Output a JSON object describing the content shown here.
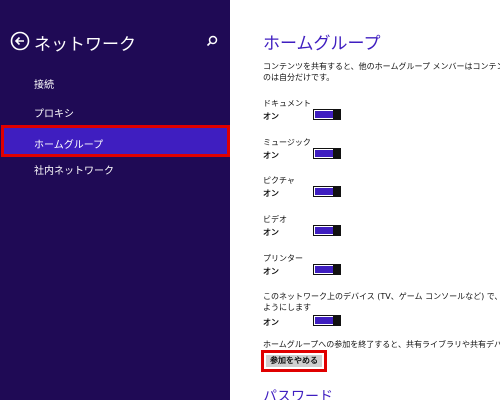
{
  "left_panel": {
    "title": "ネットワーク",
    "back_icon": "back-arrow-circle-icon",
    "search_icon": "search-icon",
    "items": [
      {
        "label": "接続"
      },
      {
        "label": "プロキシ"
      },
      {
        "label": "ホームグループ",
        "selected": true
      },
      {
        "label": "社内ネットワーク"
      }
    ],
    "accent": "#3f1ec0",
    "background": "#1f0a55"
  },
  "main": {
    "title": "ホームグループ",
    "description_line1": "コンテンツを共有すると、他のホームグループ メンバーはコンテンツを参照で",
    "description_line2": "のは自分だけです。",
    "settings": [
      {
        "label": "ドキュメント",
        "value": "オン"
      },
      {
        "label": "ミュージック",
        "value": "オン"
      },
      {
        "label": "ピクチャ",
        "value": "オン"
      },
      {
        "label": "ビデオ",
        "value": "オン"
      },
      {
        "label": "プリンター",
        "value": "オン"
      }
    ],
    "devices": {
      "line1": "このネットワーク上のデバイス (TV、ゲーム コンソールなど) で、自分の音楽",
      "line2": "ようにします",
      "value": "オン"
    },
    "leave_text": "ホームグループへの参加を終了すると、共有ライブラリや共有デバイスにア",
    "leave_button": "参加をやめる",
    "password_heading": "パスワード",
    "highlight_color": "#e00000"
  }
}
